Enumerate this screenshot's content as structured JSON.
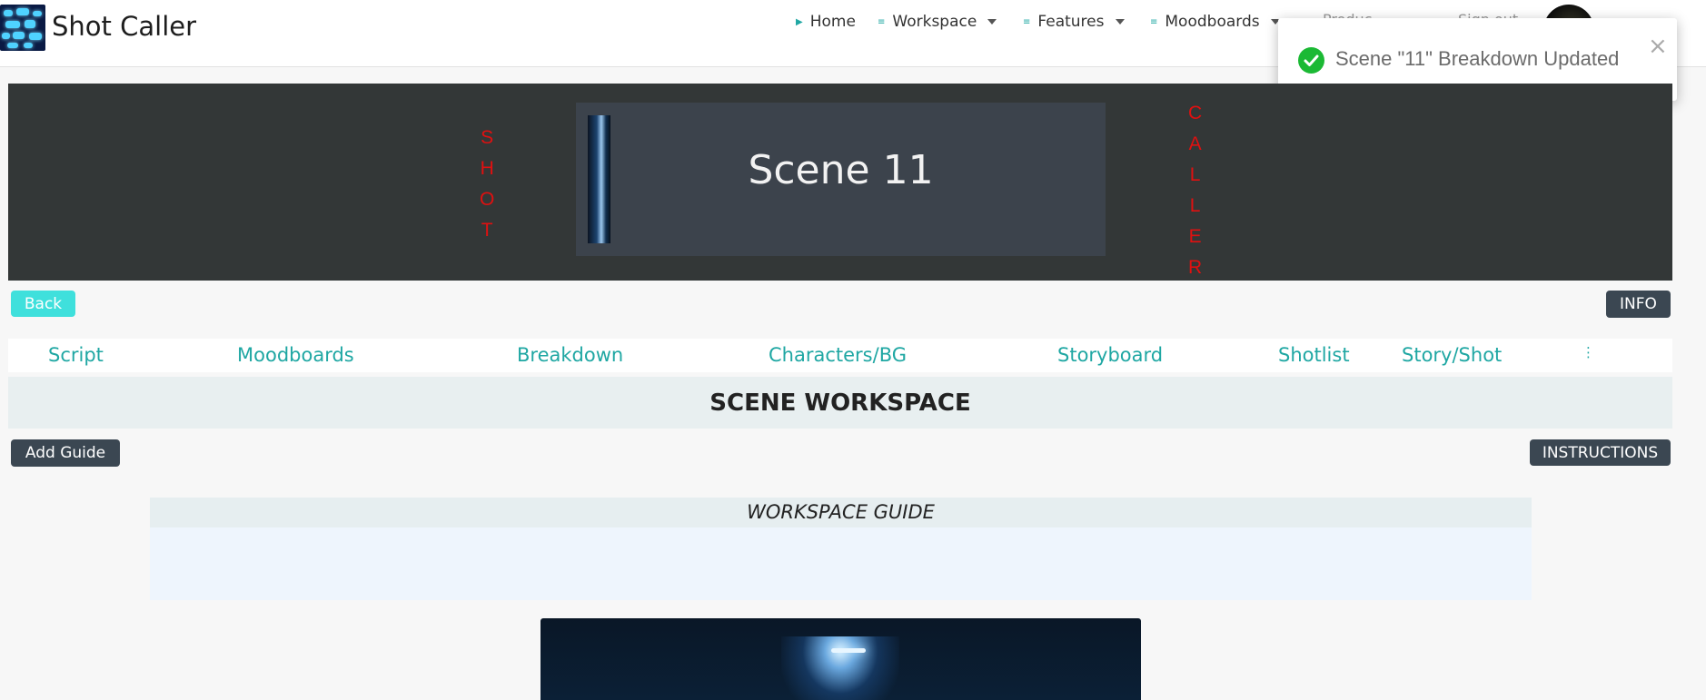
{
  "app": {
    "title": "Shot Caller"
  },
  "nav": {
    "home": "Home",
    "workspace": "Workspace",
    "features": "Features",
    "moodboards": "Moodboards",
    "faded_item_1": "Produc...",
    "faded_item_2": "Sign out"
  },
  "toast": {
    "message": "Scene \"11\" Breakdown Updated",
    "close": "×",
    "progress": 0.75
  },
  "banner": {
    "left_word": [
      "S",
      "H",
      "O",
      "T"
    ],
    "right_word": [
      "C",
      "A",
      "L",
      "L",
      "E",
      "R"
    ],
    "scene_title": "Scene 11"
  },
  "buttons": {
    "back": "Back",
    "info": "INFO",
    "add_guide": "Add Guide",
    "instructions": "INSTRUCTIONS"
  },
  "tabs": [
    {
      "label": "Script"
    },
    {
      "label": "Moodboards"
    },
    {
      "label": "Breakdown"
    },
    {
      "label": "Characters/BG"
    },
    {
      "label": "Storyboard"
    },
    {
      "label": "Shotlist"
    },
    {
      "label": "Story/Shot"
    }
  ],
  "workspace": {
    "title": "SCENE WORKSPACE",
    "guide_title": "WORKSPACE GUIDE"
  },
  "colors": {
    "accent": "#1fa7a3",
    "toast_success": "#1bb934",
    "banner_letters": "#e01010"
  }
}
